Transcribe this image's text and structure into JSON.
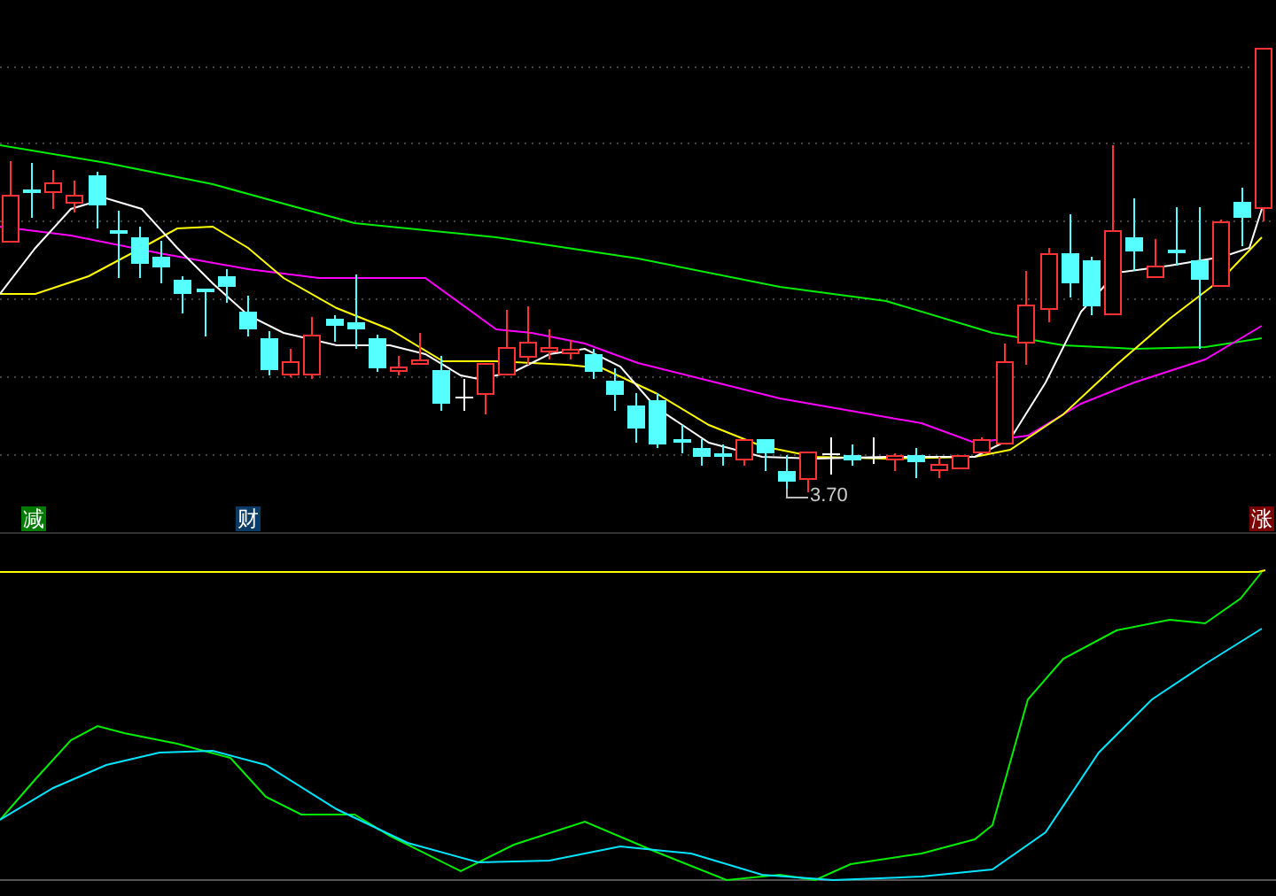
{
  "markers": [
    {
      "text": "减",
      "color": "#007a00"
    },
    {
      "text": "财",
      "color": "#0a3a66"
    },
    {
      "text": "涨",
      "color": "#7a0000"
    }
  ],
  "low_label": {
    "text": "3.70"
  }
}
